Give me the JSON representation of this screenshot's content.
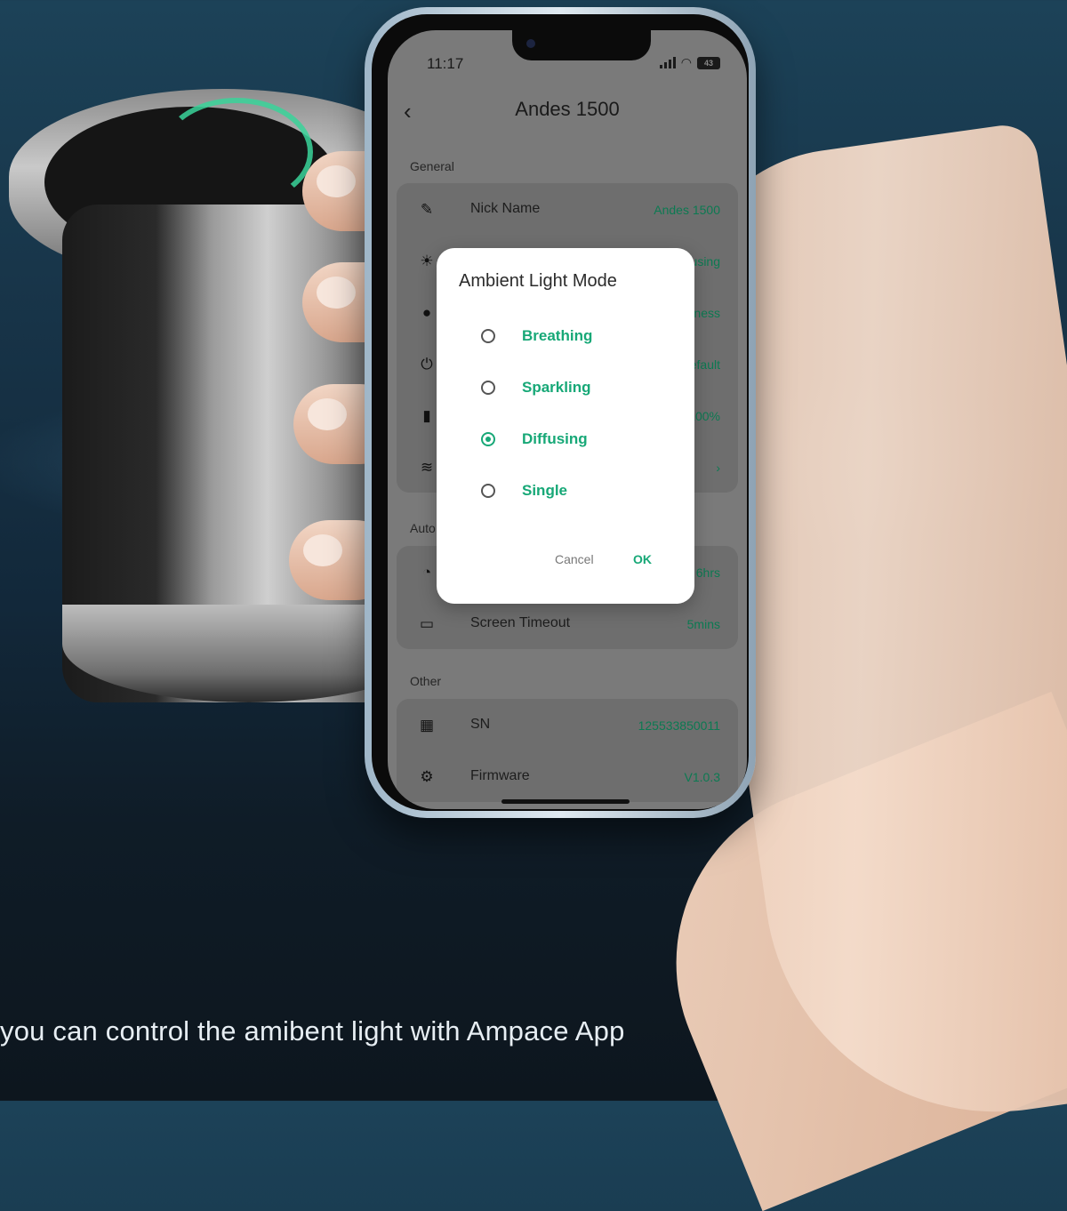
{
  "status_bar": {
    "time": "11:17",
    "battery": "43"
  },
  "nav": {
    "back_glyph": "‹",
    "title": "Andes 1500"
  },
  "sections": {
    "general": "General",
    "auto": "Auto",
    "other": "Other"
  },
  "general_rows": [
    {
      "icon": "pen-icon",
      "glyph": "✎",
      "label": "Nick Name",
      "value": "Andes 1500"
    },
    {
      "icon": "sunrise-icon",
      "glyph": "☀",
      "label": "",
      "value": "Diffusing"
    },
    {
      "icon": "bulb-icon",
      "glyph": "●",
      "label": "",
      "value": "Brightness"
    },
    {
      "icon": "plug-icon",
      "glyph": "⏻",
      "label": "",
      "value": "Default"
    },
    {
      "icon": "battery-icon",
      "glyph": "▮",
      "label": "",
      "value": "100%"
    },
    {
      "icon": "wifi-icon",
      "glyph": "≋",
      "label": "",
      "value": "›"
    }
  ],
  "auto_rows": [
    {
      "icon": "timer-icon",
      "glyph": "◔",
      "label": "",
      "value": "6hrs"
    },
    {
      "icon": "screen-icon",
      "glyph": "▭",
      "label": "Screen Timeout",
      "value": "5mins"
    }
  ],
  "other_rows": [
    {
      "icon": "qr-code-icon",
      "glyph": "▦",
      "label": "SN",
      "value": "125533850011"
    },
    {
      "icon": "chip-icon",
      "glyph": "⚙",
      "label": "Firmware",
      "value": "V1.0.3"
    }
  ],
  "dialog": {
    "title": "Ambient Light Mode",
    "options": [
      "Breathing",
      "Sparkling",
      "Diffusing",
      "Single"
    ],
    "selected": "Diffusing",
    "cancel_label": "Cancel",
    "ok_label": "OK"
  },
  "caption": "you can control the amibent light with Ampace App",
  "colors": {
    "accent": "#17a877",
    "value_green": "#0c7a52"
  }
}
